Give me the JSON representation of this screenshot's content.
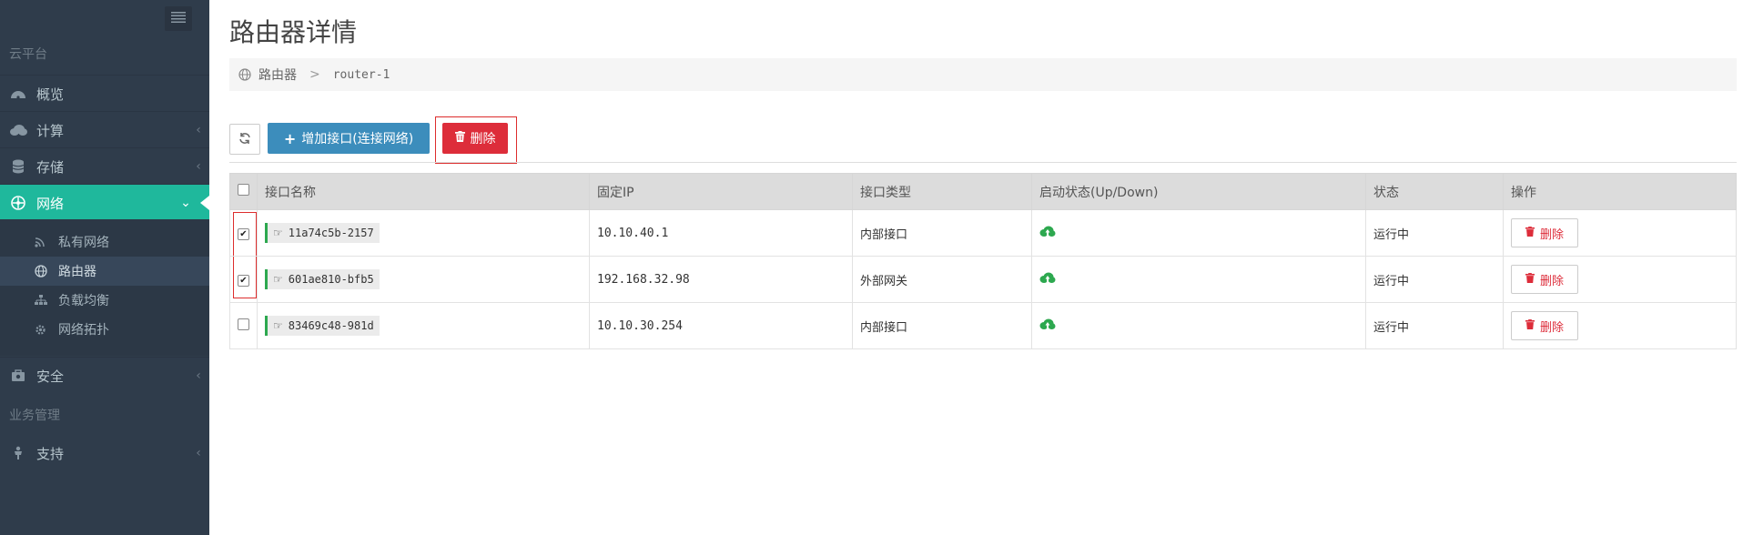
{
  "sidebar": {
    "section_cloud": "云平台",
    "section_business": "业务管理",
    "items": [
      {
        "label": "概览"
      },
      {
        "label": "计算"
      },
      {
        "label": "存储"
      },
      {
        "label": "网络"
      },
      {
        "label": "安全"
      },
      {
        "label": "支持"
      }
    ],
    "network_sub": [
      {
        "label": "私有网络"
      },
      {
        "label": "路由器"
      },
      {
        "label": "负载均衡"
      },
      {
        "label": "网络拓扑"
      }
    ]
  },
  "page": {
    "title": "路由器详情",
    "breadcrumb": {
      "root": "路由器",
      "current": "router-1"
    }
  },
  "toolbar": {
    "add_label": "增加接口(连接网络)",
    "delete_label": "删除"
  },
  "table": {
    "headers": [
      "接口名称",
      "固定IP",
      "接口类型",
      "启动状态(Up/Down)",
      "状态",
      "操作"
    ],
    "rows": [
      {
        "name": "11a74c5b-2157",
        "ip": "10.10.40.1",
        "type": "内部接口",
        "status": "运行中",
        "action": "删除",
        "checked": true
      },
      {
        "name": "601ae810-bfb5",
        "ip": "192.168.32.98",
        "type": "外部网关",
        "status": "运行中",
        "action": "删除",
        "checked": true
      },
      {
        "name": "83469c48-981d",
        "ip": "10.10.30.254",
        "type": "内部接口",
        "status": "运行中",
        "action": "删除",
        "checked": false
      }
    ]
  },
  "colors": {
    "sidebar_bg": "#2f3c4b",
    "active_nav": "#1fb89c",
    "primary": "#3c8dbc",
    "danger": "#dd2d3a",
    "up_green": "#2da84f"
  },
  "icons": [
    "menu-icon",
    "dashboard-icon",
    "cloud-icon",
    "database-icon",
    "network-icon",
    "shield-icon",
    "support-icon",
    "rss-icon",
    "globe-icon",
    "sitemap-icon",
    "cog-icon",
    "refresh-icon",
    "plus-icon",
    "trash-icon",
    "hand-pointer-icon",
    "cloud-upload-icon",
    "chevron-left-icon",
    "chevron-down-icon"
  ]
}
